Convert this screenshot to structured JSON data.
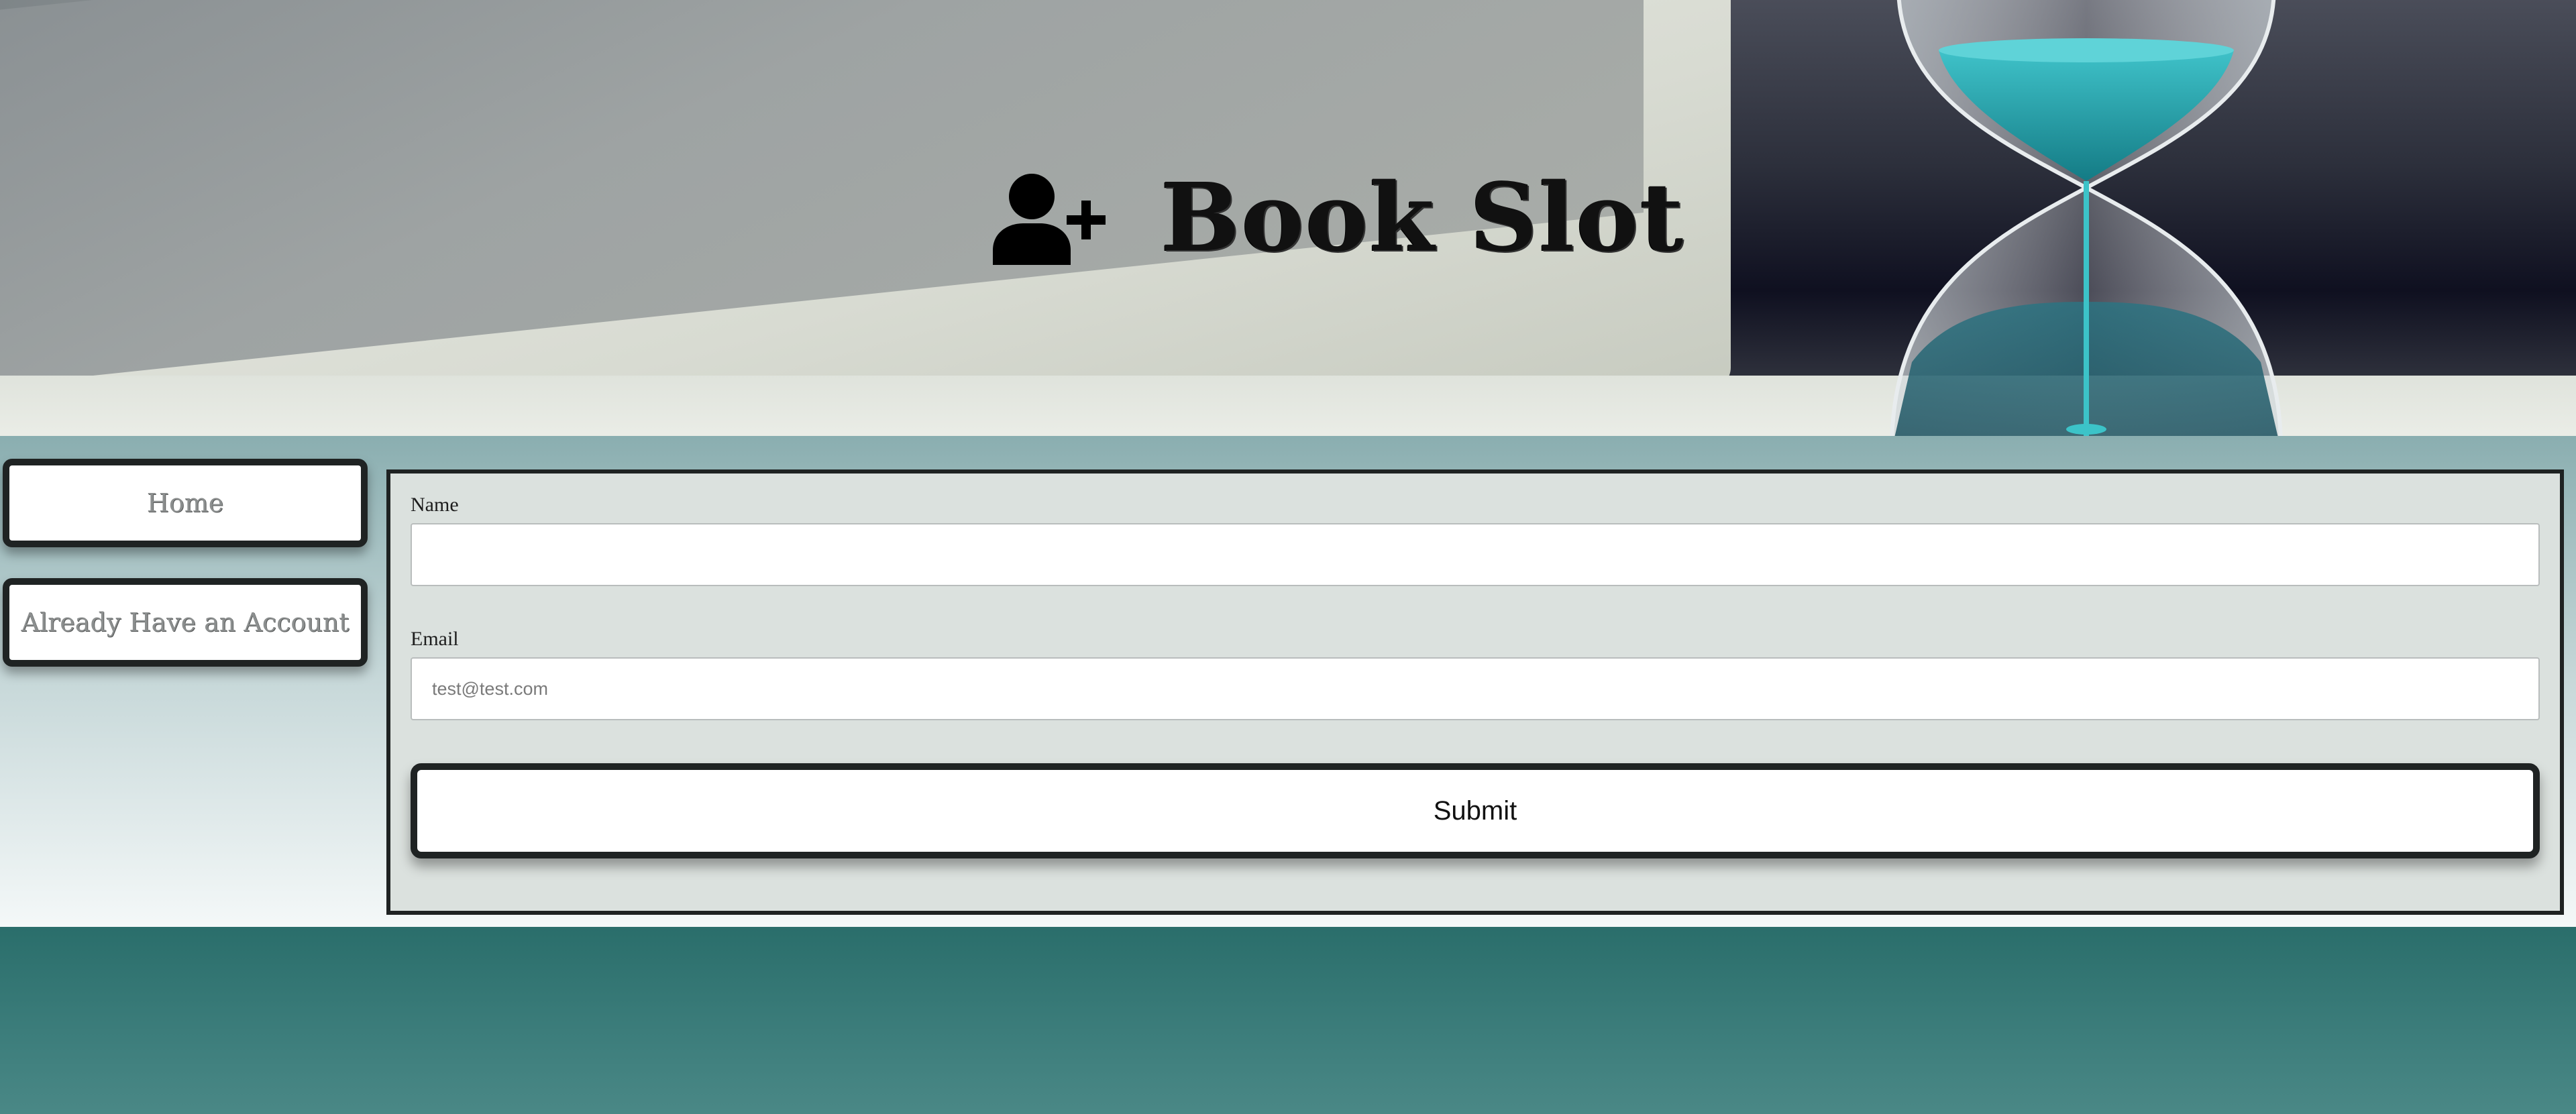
{
  "header": {
    "title": "Book Slot",
    "icon": "user-plus-icon"
  },
  "sidebar": {
    "items": [
      {
        "label": "Home"
      },
      {
        "label": "Already Have an Account"
      }
    ]
  },
  "form": {
    "name": {
      "label": "Name",
      "value": "",
      "placeholder": ""
    },
    "email": {
      "label": "Email",
      "value": "",
      "placeholder": "test@test.com"
    },
    "submit_label": "Submit"
  },
  "colors": {
    "panel_bg": "#dbe1de",
    "border_dark": "#1f2323",
    "footer_teal": "#2b6f6c",
    "hourglass_sand": "#2aa3ad"
  }
}
